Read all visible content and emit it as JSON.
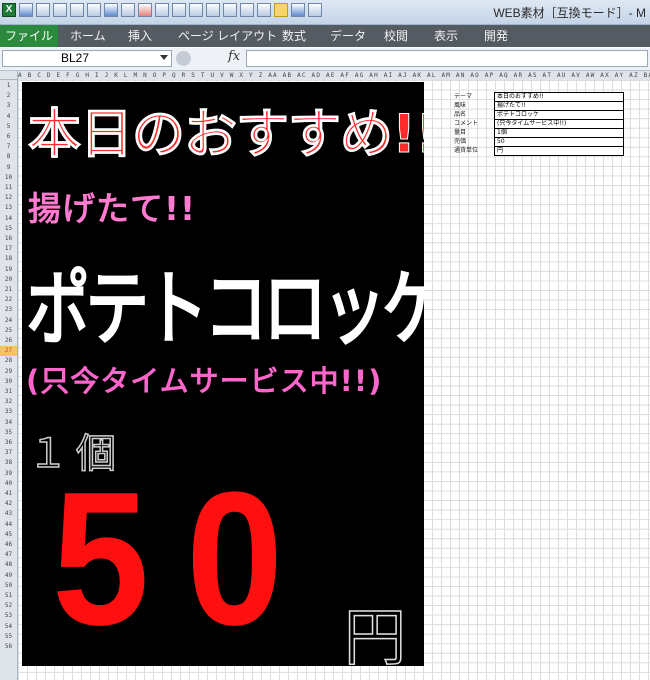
{
  "window": {
    "title": "WEB素材［互換モード］- M",
    "app_icon_letter": "X"
  },
  "ribbon": {
    "tabs": [
      {
        "label": "ファイル"
      },
      {
        "label": "ホーム"
      },
      {
        "label": "挿入"
      },
      {
        "label": "ページ レイアウト"
      },
      {
        "label": "数式"
      },
      {
        "label": "データ"
      },
      {
        "label": "校閲"
      },
      {
        "label": "表示"
      },
      {
        "label": "開発"
      }
    ]
  },
  "formula_bar": {
    "cell_reference": "BL27",
    "fx_label": "fx",
    "formula_value": ""
  },
  "sheet": {
    "selected_row": 27,
    "row_count": 56,
    "column_headers": "A B C D E F G H I J K L M N O P Q R S T U V W X Y Z AA AB AC AD AE AF AG AH AI AJ AK AL AM AN AO AP AQ AR AS AT AU AV AW AX AY AZ BA BB BC BD BE BF BG BH BI"
  },
  "poster": {
    "line1": "本日のおすすめ!!",
    "line2": "揚げたて!!",
    "product": "ポテトコロッケ",
    "tagline": "(只今タイムサービス中!!)",
    "quantity": "１個",
    "price": "50",
    "unit": "円",
    "colors": {
      "background": "#000000",
      "headline": "#ff2a2a",
      "subhead": "#ff7ad0",
      "product": "#ffffff",
      "tagline": "#ff66cc",
      "price": "#ff1010"
    }
  },
  "info_table": {
    "rows": [
      {
        "key": "テーマ",
        "value": "本日のおすすめ!!"
      },
      {
        "key": "風味",
        "value": "揚げたて!!"
      },
      {
        "key": "品名",
        "value": "ポテトコロッケ"
      },
      {
        "key": "コメント",
        "value": "(只今タイムサービス中!!)"
      },
      {
        "key": "量目",
        "value": "1個"
      },
      {
        "key": "売価",
        "value": "50"
      },
      {
        "key": "通貨単位",
        "value": "円"
      }
    ]
  }
}
